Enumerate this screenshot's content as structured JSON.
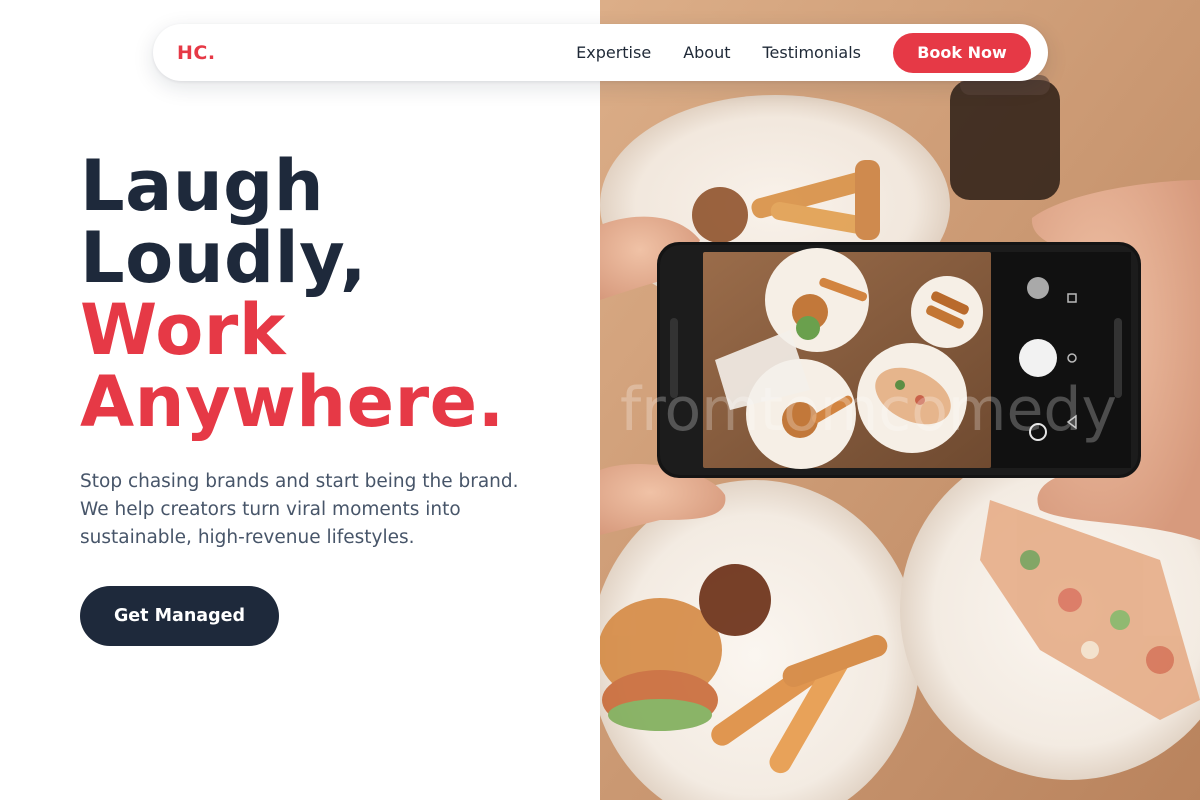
{
  "nav": {
    "logo": "HC.",
    "links": [
      "Expertise",
      "About",
      "Testimonials"
    ],
    "cta": "Book Now"
  },
  "hero": {
    "headline_dark_1": "Laugh",
    "headline_dark_2": "Loudly,",
    "headline_red_1": "Work",
    "headline_red_2": "Anywhere.",
    "subtext": "Stop chasing brands and start being the brand. We help creators turn viral moments into sustainable, high-revenue lifestyles.",
    "cta": "Get Managed"
  },
  "image": {
    "watermark": "fromtomcomedy",
    "subject": "hands photographing food plates with a smartphone"
  },
  "colors": {
    "accent": "#e63946",
    "dark": "#1e293b",
    "body_text": "#475569"
  }
}
